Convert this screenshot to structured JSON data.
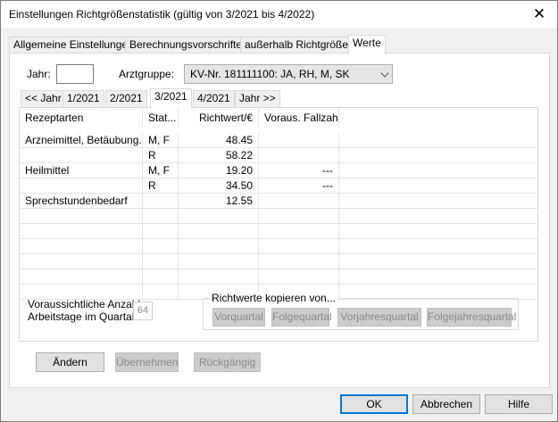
{
  "window": {
    "title": "Einstellungen Richtgrößenstatistik (gültig von 3/2021 bis 4/2022)"
  },
  "icons": {
    "close": "close-icon"
  },
  "tabs": [
    {
      "label": "Allgemeine Einstellungen"
    },
    {
      "label": "Berechnungsvorschriften"
    },
    {
      "label": "außerhalb Richtgrößen"
    },
    {
      "label": "Werte"
    }
  ],
  "filter": {
    "jahr_label": "Jahr:",
    "jahr_value": "",
    "arztgruppe_label": "Arztgruppe:",
    "arztgruppe_value": "KV-Nr. 181111100: JA, RH, M, SK"
  },
  "quarter_tabs": [
    {
      "label": "<< Jahr"
    },
    {
      "label": "1/2021"
    },
    {
      "label": "2/2021"
    },
    {
      "label": "3/2021"
    },
    {
      "label": "4/2021"
    },
    {
      "label": "Jahr >>"
    }
  ],
  "grid": {
    "columns": [
      "Rezeptarten",
      "Stat...",
      "Richtwert/€",
      "Voraus. Fallzahl"
    ],
    "rows": [
      {
        "rezeptart": "Arzneimittel, Betäubung...",
        "status": "M, F",
        "richtwert": "48.45",
        "fallzahl": ""
      },
      {
        "rezeptart": "",
        "status": "R",
        "richtwert": "58.22",
        "fallzahl": ""
      },
      {
        "rezeptart": "Heilmittel",
        "status": "M, F",
        "richtwert": "19.20",
        "fallzahl": "---"
      },
      {
        "rezeptart": "",
        "status": "R",
        "richtwert": "34.50",
        "fallzahl": "---"
      },
      {
        "rezeptart": "Sprechstundenbedarf",
        "status": "",
        "richtwert": "12.55",
        "fallzahl": ""
      }
    ]
  },
  "arbeitstage": {
    "label_line1": "Voraussichtliche Anzahl",
    "label_line2": "Arbeitstage im Quartal:",
    "value": "64"
  },
  "kopieren": {
    "title": "Richtwerte kopieren von...",
    "buttons": [
      "Vorquartal",
      "Folgequartal",
      "Vorjahresquartal",
      "Folgejahresquartal"
    ]
  },
  "actions": {
    "aendern": "Ändern",
    "uebernehmen": "Übernehmen",
    "rueckgaengig": "Rückgängig"
  },
  "dialog_buttons": {
    "ok": "OK",
    "abbrechen": "Abbrechen",
    "hilfe": "Hilfe"
  }
}
